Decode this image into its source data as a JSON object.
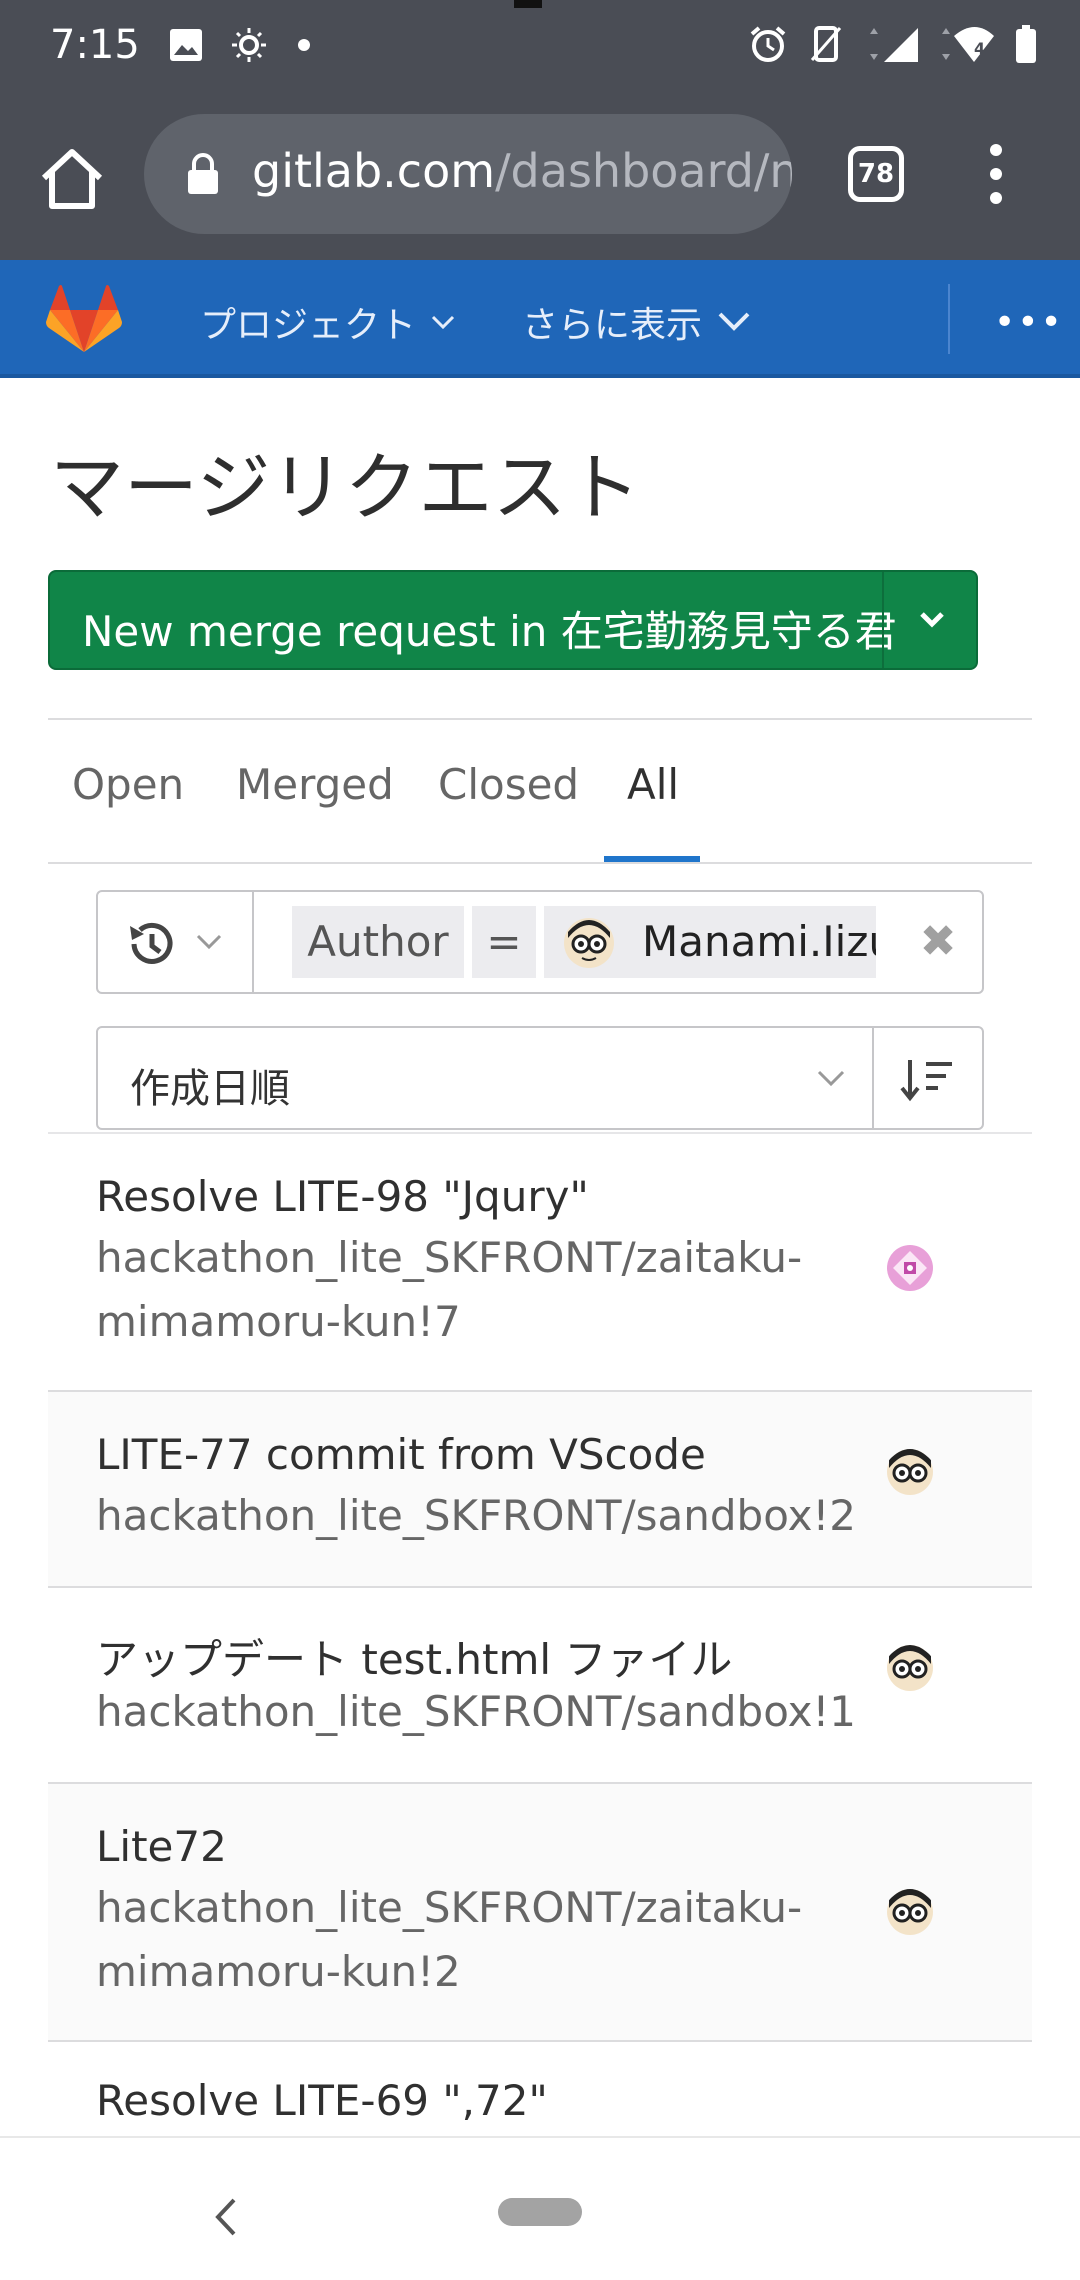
{
  "status_bar": {
    "time": "7:15",
    "left_icons": [
      "image-icon",
      "brightness-icon",
      "dot-icon"
    ],
    "right_icons": [
      "alarm-icon",
      "vibrate-icon",
      "signal-icon",
      "wifi-icon",
      "battery-icon"
    ],
    "wifi_label": "4"
  },
  "browser": {
    "url_host": "gitlab.com",
    "url_path": "/dashboard/n",
    "tab_count": "78"
  },
  "gitlab_nav": {
    "projects_label": "プロジェクト",
    "more_label": "さらに表示",
    "overflow_label": "•••"
  },
  "page": {
    "title": "マージリクエスト",
    "new_mr_label": "New merge request in 在宅勤務見守る君"
  },
  "tabs": [
    {
      "label": "Open",
      "active": false
    },
    {
      "label": "Merged",
      "active": false
    },
    {
      "label": "Closed",
      "active": false
    },
    {
      "label": "All",
      "active": true
    }
  ],
  "filter": {
    "token_field": "Author",
    "token_operator": "=",
    "token_value": "Manami.Iizu",
    "clear_symbol": "✖"
  },
  "sort": {
    "label": "作成日順"
  },
  "merge_requests": [
    {
      "title": "Resolve LITE-98 \"Jqury\"",
      "ref_line1": "hackathon_lite_SKFRONT/zaitaku-",
      "ref_line2": "mimamoru-kun!7",
      "avatar": "pattern-avatar"
    },
    {
      "title": "LITE-77 commit from VScode",
      "ref_line1": "hackathon_lite_SKFRONT/sandbox!2",
      "ref_line2": "",
      "avatar": "user-avatar"
    },
    {
      "title": "アップデート test.html ファイル",
      "ref_line1": "hackathon_lite_SKFRONT/sandbox!1",
      "ref_line2": "",
      "avatar": "user-avatar"
    },
    {
      "title": "Lite72",
      "ref_line1": "hackathon_lite_SKFRONT/zaitaku-",
      "ref_line2": "mimamoru-kun!2",
      "avatar": "user-avatar"
    },
    {
      "title": "Resolve LITE-69 \",72\"",
      "ref_line1": "",
      "ref_line2": "",
      "avatar": ""
    }
  ],
  "colors": {
    "nav_blue": "#1f66b8",
    "button_green": "#108548",
    "tab_active": "#1f75cb",
    "status_bar": "#4a4d55"
  }
}
